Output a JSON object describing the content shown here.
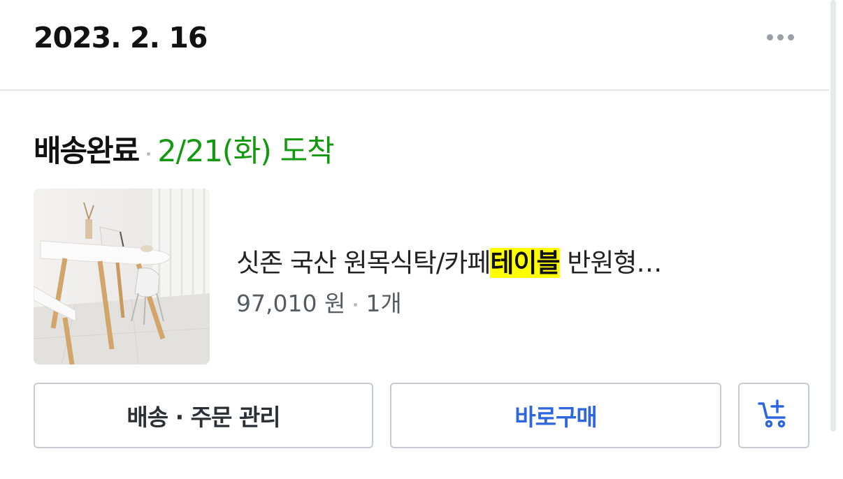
{
  "order": {
    "date": "2023. 2. 16"
  },
  "delivery": {
    "status": "배송완료",
    "arrival": "2/21(화) 도착"
  },
  "product": {
    "name_before": "싯존 국산 원목식탁/카페",
    "name_highlight": "테이블",
    "name_after": " 반원형…",
    "price": "97,010 원",
    "quantity": "1개"
  },
  "actions": {
    "manage_label": "배송 · 주문 관리",
    "buy_label": "바로구매"
  },
  "icons": {
    "more": "more-horizontal-icon",
    "cart_add": "cart-add-icon"
  },
  "colors": {
    "arrival_green": "#13990f",
    "buy_blue": "#2e66e0",
    "highlight_yellow": "#ffff00"
  }
}
